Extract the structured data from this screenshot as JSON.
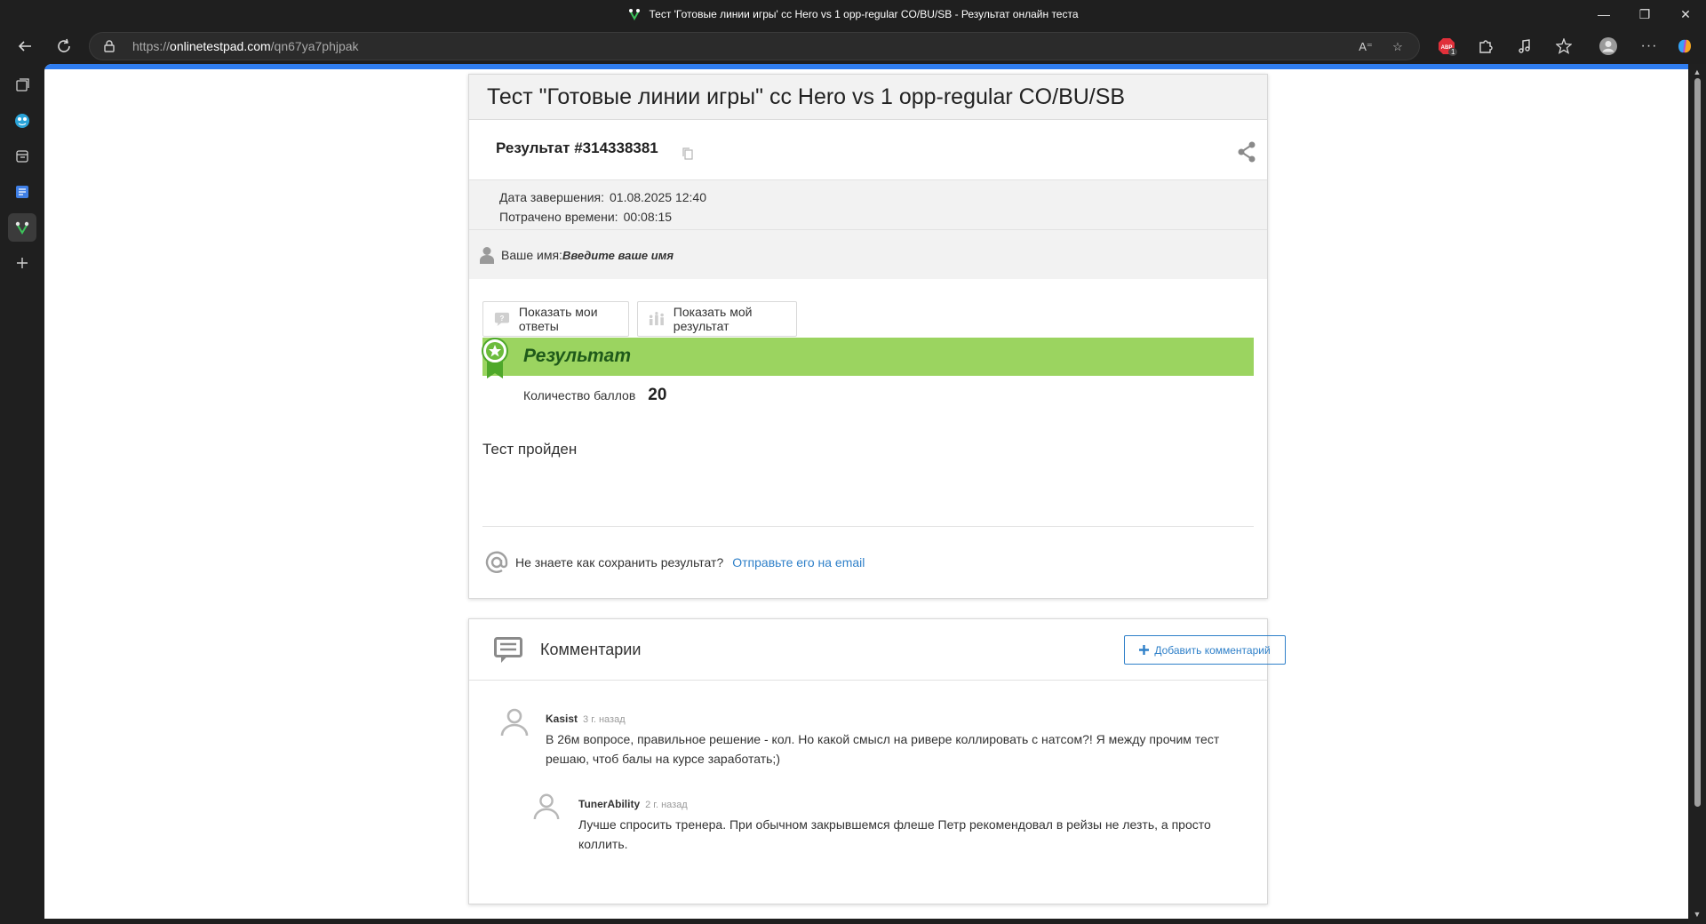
{
  "window": {
    "title": "Тест 'Готовые линии игры' cc Hero vs 1 opp-regular CO/BU/SB - Результат онлайн теста"
  },
  "browser": {
    "url_scheme": "https://",
    "url_host": "onlinetestpad.com",
    "url_path": "/qn67ya7phjpak",
    "adblock_badge": "1"
  },
  "page": {
    "test_title": "Тест \"Готовые линии игры\" cc Hero vs 1 opp-regular CO/BU/SB",
    "result_label": "Результат #314338381",
    "finish_label": "Дата завершения:",
    "finish_value": "01.08.2025 12:40",
    "time_label": "Потрачено времени:",
    "time_value": "00:08:15",
    "name_label": "Ваше имя:",
    "name_value": "Введите ваше имя",
    "show_answers_button": "Показать мои ответы",
    "show_result_button": "Показать мой результат",
    "result_heading": "Результат",
    "score_label": "Количество баллов",
    "score_value": "20",
    "passed_text": "Тест пройден",
    "save_question": "Не знаете как сохранить результат?",
    "send_email_link": "Отправьте его на email"
  },
  "comments": {
    "title": "Комментарии",
    "add_button": "Добавить комментарий",
    "items": [
      {
        "author": "Kasist",
        "ago": "3 г. назад",
        "text": "В 26м вопросе, правильное решение - кол. Но какой смысл на ривере коллировать с натсом?! Я между прочим тест решаю, чтоб балы на курсе заработать;)"
      },
      {
        "author": "TunerAbility",
        "ago": "2 г. назад",
        "text": "Лучше спросить тренера. При обычном закрывшемся флеше Петр рекомендовал в рейзы не лезть, а просто коллить."
      }
    ]
  },
  "colors": {
    "accent": "#2f7df0",
    "banner": "#9bd460",
    "link": "#2f80c9"
  }
}
